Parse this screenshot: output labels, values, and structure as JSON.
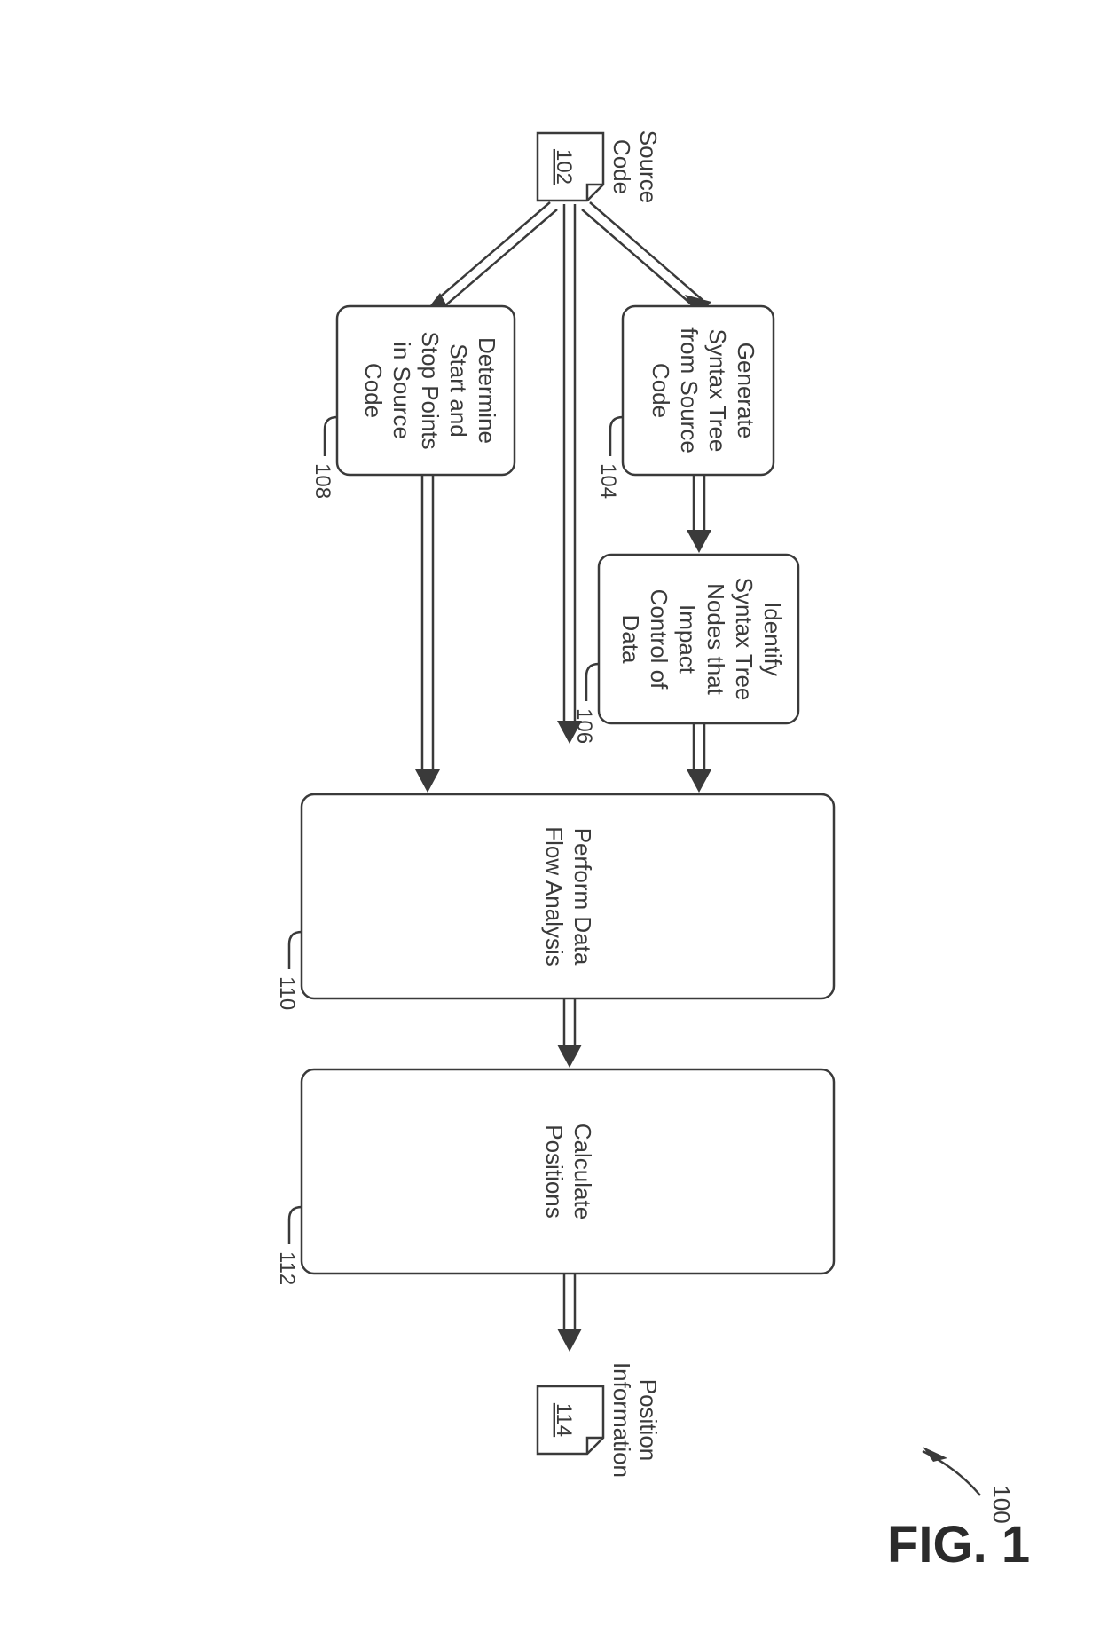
{
  "figure_label": "FIG. 1",
  "flow_ref": "100",
  "docs": {
    "source": {
      "label_line1": "Source",
      "label_line2": "Code",
      "ref": "102"
    },
    "output": {
      "label_line1": "Position",
      "label_line2": "Information",
      "ref": "114"
    }
  },
  "boxes": {
    "gen_tree": {
      "l1": "Generate",
      "l2": "Syntax Tree",
      "l3": "from Source",
      "l4": "Code",
      "ref": "104"
    },
    "identify": {
      "l1": "Identify",
      "l2": "Syntax Tree",
      "l3": "Nodes that",
      "l4": "Impact",
      "l5": "Control of",
      "l6": "Data",
      "ref": "106"
    },
    "startstop": {
      "l1": "Determine",
      "l2": "Start and",
      "l3": "Stop Points",
      "l4": "in Source",
      "l5": "Code",
      "ref": "108"
    },
    "flow": {
      "l1": "Perform Data",
      "l2": "Flow Analysis",
      "ref": "110"
    },
    "calc": {
      "l1": "Calculate",
      "l2": "Positions",
      "ref": "112"
    }
  }
}
